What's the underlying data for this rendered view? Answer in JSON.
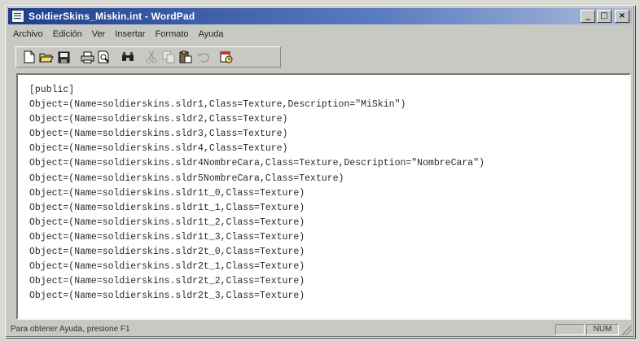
{
  "window": {
    "title": "SoldierSkins_Miskin.int - WordPad",
    "controls": {
      "minimize": "_",
      "maximize": "□",
      "close": "×"
    }
  },
  "menu": [
    "Archivo",
    "Edición",
    "Ver",
    "Insertar",
    "Formato",
    "Ayuda"
  ],
  "toolbar": {
    "buttons": [
      "new-icon",
      "open-icon",
      "save-icon",
      "print-icon",
      "print-preview-icon",
      "find-icon",
      "cut-icon",
      "copy-icon",
      "paste-icon",
      "undo-icon",
      "date-time-icon"
    ]
  },
  "document": {
    "lines": [
      "[public]",
      "Object=(Name=soldierskins.sldr1,Class=Texture,Description=\"MiSkin\")",
      "Object=(Name=soldierskins.sldr2,Class=Texture)",
      "Object=(Name=soldierskins.sldr3,Class=Texture)",
      "Object=(Name=soldierskins.sldr4,Class=Texture)",
      "Object=(Name=soldierskins.sldr4NombreCara,Class=Texture,Description=\"NombreCara\")",
      "Object=(Name=soldierskins.sldr5NombreCara,Class=Texture)",
      "Object=(Name=soldierskins.sldr1t_0,Class=Texture)",
      "Object=(Name=soldierskins.sldr1t_1,Class=Texture)",
      "Object=(Name=soldierskins.sldr1t_2,Class=Texture)",
      "Object=(Name=soldierskins.sldr1t_3,Class=Texture)",
      "Object=(Name=soldierskins.sldr2t_0,Class=Texture)",
      "Object=(Name=soldierskins.sldr2t_1,Class=Texture)",
      "Object=(Name=soldierskins.sldr2t_2,Class=Texture)",
      "Object=(Name=soldierskins.sldr2t_3,Class=Texture)"
    ]
  },
  "status": {
    "help_text": "Para obtener Ayuda, presione F1",
    "num_indicator": "NUM"
  },
  "colors": {
    "titlebar_start": "#1f3f8f",
    "titlebar_end": "#a9b9da",
    "window_face": "#c9c9c4",
    "document_bg": "#ffffff"
  }
}
